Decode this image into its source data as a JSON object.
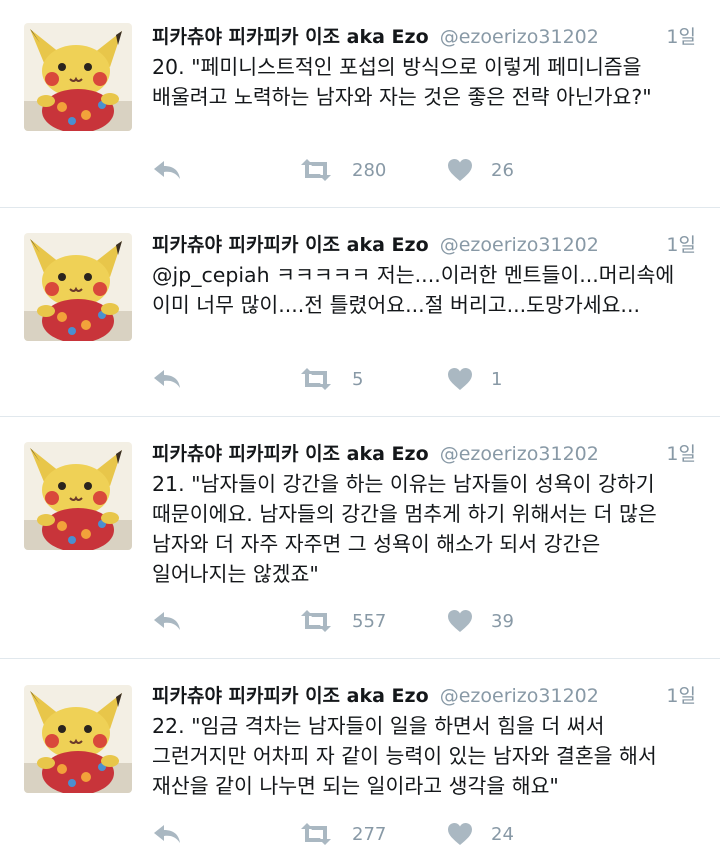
{
  "tweets": [
    {
      "display_name": "피카츄야 피카피카 이조 aka Ezo",
      "handle": "@ezoerizo31202",
      "time": "1일",
      "text": "20. \"페미니스트적인 포섭의 방식으로 이렇게 페미니즘을\n배울려고 노력하는 남자와 자는 것은 좋은 전략 아닌가요?\"",
      "retweets": "280",
      "likes": "26"
    },
    {
      "display_name": "피카츄야 피카피카 이조 aka Ezo",
      "handle": "@ezoerizo31202",
      "time": "1일",
      "text": "@jp_cepiah ㅋㅋㅋㅋㅋ 저는....이러한 멘트들이...머리속에\n이미 너무 많이....전 틀렸어요...절 버리고...도망가세요...",
      "retweets": "5",
      "likes": "1"
    },
    {
      "display_name": "피카츄야 피카피카 이조 aka Ezo",
      "handle": "@ezoerizo31202",
      "time": "1일",
      "text": "21. \"남자들이 강간을 하는 이유는 남자들이 성욕이 강하기\n때문이에요. 남자들의 강간을 멈추게 하기 위해서는 더 많은\n남자와 더 자주 자주면 그 성욕이 해소가 되서 강간은\n일어나지는 않겠죠\"",
      "retweets": "557",
      "likes": "39"
    },
    {
      "display_name": "피카츄야 피카피카 이조 aka Ezo",
      "handle": "@ezoerizo31202",
      "time": "1일",
      "text": "22. \"임금 격차는 남자들이 일을 하면서 힘을 더 써서\n그런거지만 어차피 자 같이 능력이 있는 남자와 결혼을 해서\n재산을 같이 나누면 되는 일이라고 생각을 해요\"",
      "retweets": "277",
      "likes": "24"
    }
  ],
  "icons": {
    "reply": "reply-arrow",
    "retweet": "retweet-arrows",
    "like": "heart"
  },
  "colors": {
    "icon": "#aab8c2",
    "secondary_text": "#8899a6",
    "divider": "#e1e8ed"
  }
}
